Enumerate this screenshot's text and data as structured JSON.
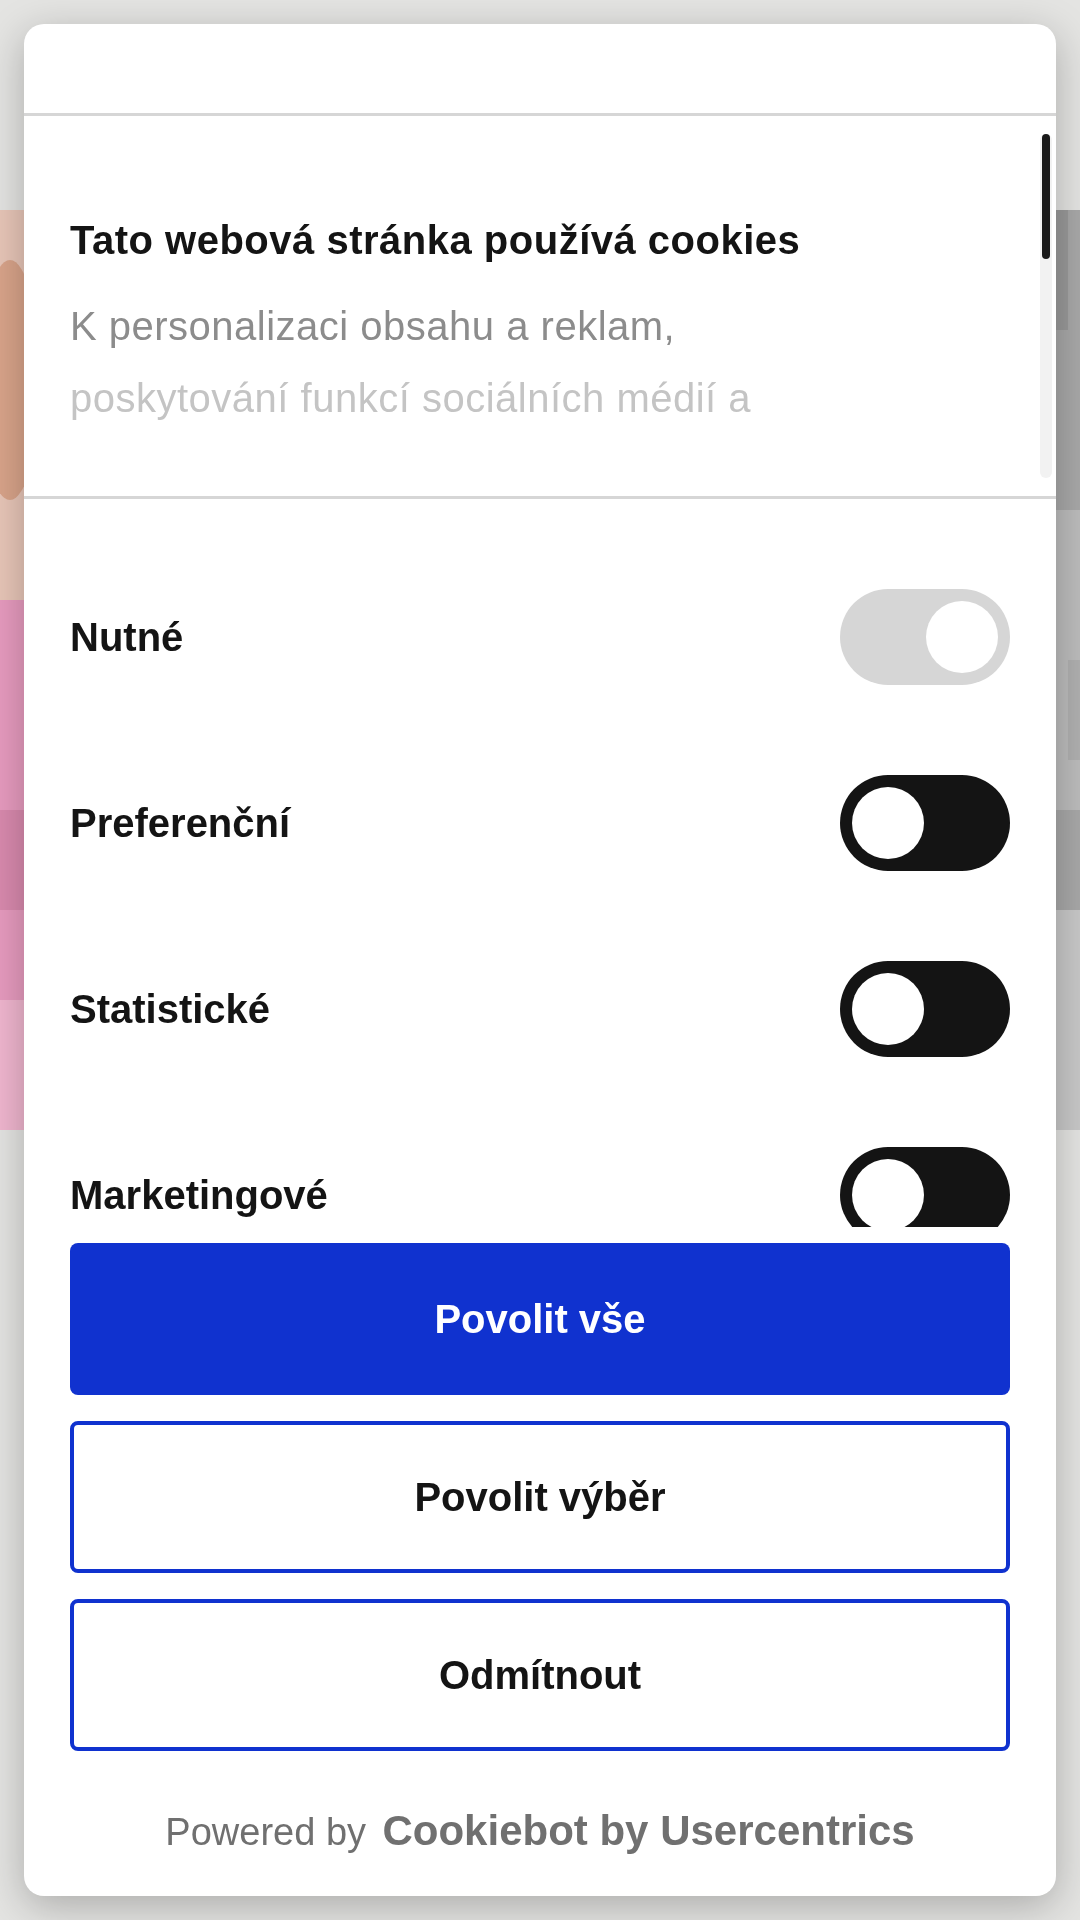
{
  "dialog": {
    "title": "Tato webová stránka používá cookies",
    "description": [
      "K personalizaci obsahu a reklam,",
      "poskytování funkcí sociálních médií a"
    ]
  },
  "categories": [
    {
      "label": "Nutné",
      "checked": true,
      "disabled": true
    },
    {
      "label": "Preferenční",
      "checked": false,
      "disabled": false
    },
    {
      "label": "Statistické",
      "checked": false,
      "disabled": false
    },
    {
      "label": "Marketingové",
      "checked": false,
      "disabled": false
    }
  ],
  "buttons": [
    {
      "label": "Povolit vše",
      "kind": "primary"
    },
    {
      "label": "Povolit výběr",
      "kind": "outline"
    },
    {
      "label": "Odmítnout",
      "kind": "outline"
    }
  ],
  "footer": {
    "prefix": "Powered by",
    "brand": "Cookiebot by Usercentrics"
  }
}
